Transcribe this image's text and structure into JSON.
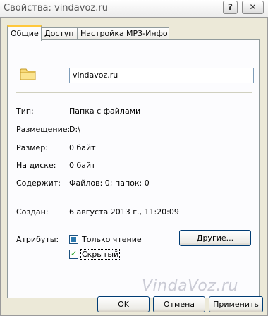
{
  "window": {
    "title": "Свойства: vindavoz.ru",
    "help_button": "?",
    "close_button": "✕"
  },
  "tabs": [
    {
      "label": "Общие",
      "active": true
    },
    {
      "label": "Доступ",
      "active": false
    },
    {
      "label": "Настройка",
      "active": false
    },
    {
      "label": "MP3-Инфо",
      "active": false
    }
  ],
  "general": {
    "icon": "folder-icon",
    "name_value": "vindavoz.ru",
    "type_label": "Тип:",
    "type_value": "Папка с файлами",
    "location_label": "Размещение:",
    "location_value": "D:\\",
    "size_label": "Размер:",
    "size_value": "0 байт",
    "disk_size_label": "На диске:",
    "disk_size_value": "0 байт",
    "contains_label": "Содержит:",
    "contains_value": "Файлов: 0; папок: 0",
    "created_label": "Создан:",
    "created_value": "6 августа 2013 г., 11:20:09",
    "attributes_label": "Атрибуты:",
    "readonly_label": "Только чтение",
    "readonly_state": "indeterminate",
    "hidden_label": "Скрытый",
    "hidden_state": "checked",
    "other_button": "Другие..."
  },
  "footer": {
    "ok_button": "OK",
    "cancel_button": "Отмена",
    "apply_button": "Применить"
  },
  "watermark": "VindaVoz.ru",
  "colors": {
    "dialog_bg": "#ece9d8",
    "panel_bg": "#fcfcfe",
    "active_tab_accent": "#ffc83c",
    "check_mark": "#21a121"
  }
}
